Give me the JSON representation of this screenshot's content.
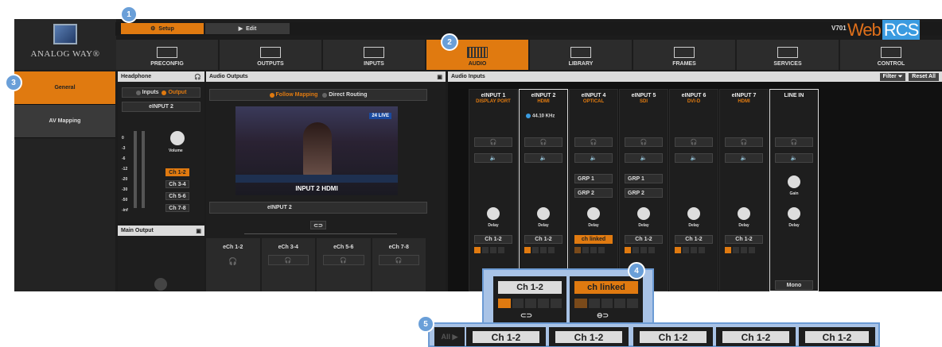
{
  "header": {
    "tabs": [
      {
        "label": "Setup"
      },
      {
        "label": "Edit"
      }
    ],
    "version": "V701",
    "brand_web": "Web",
    "brand_rcs": "RCS",
    "logo_text": "ANALOG WAY®"
  },
  "menu": [
    {
      "label": "PRECONFIG"
    },
    {
      "label": "OUTPUTS"
    },
    {
      "label": "INPUTS"
    },
    {
      "label": "AUDIO"
    },
    {
      "label": "LIBRARY"
    },
    {
      "label": "FRAMES"
    },
    {
      "label": "SERVICES"
    },
    {
      "label": "CONTROL"
    }
  ],
  "sidebar": {
    "items": [
      {
        "label": "General"
      },
      {
        "label": "AV Mapping"
      }
    ]
  },
  "headphone": {
    "title": "Headphone",
    "inputs": "Inputs",
    "output": "Output",
    "source": "eINPUT 2",
    "volume": "Volume",
    "scale": [
      "0",
      "-3",
      "-6",
      "-12",
      "-20",
      "-30",
      "-50",
      "-inf"
    ],
    "channels": [
      "Ch 1-2",
      "Ch 3-4",
      "Ch 5-6",
      "Ch 7-8"
    ]
  },
  "main_output": {
    "title": "Main Output"
  },
  "audio_outputs": {
    "title": "Audio Outputs",
    "follow": "Follow Mapping",
    "direct": "Direct Routing",
    "video_caption": "INPUT 2  HDMI",
    "video_tag": "24 LIVE",
    "selected": "eINPUT 2",
    "link": "⊂⊃",
    "outs": [
      "eCh 1-2",
      "eCh 3-4",
      "eCh 5-6",
      "eCh 7-8"
    ]
  },
  "audio_inputs": {
    "title": "Audio Inputs",
    "filter": "Filter",
    "reset": "Reset All",
    "freq": "44.10 KHz",
    "grp1": "GRP 1",
    "grp2": "GRP 2",
    "delay": "Delay",
    "gain": "Gain",
    "mono": "Mono",
    "channels": [
      {
        "name": "eINPUT 1",
        "type": "DISPLAY PORT",
        "ch": "Ch 1-2"
      },
      {
        "name": "eINPUT 2",
        "type": "HDMI",
        "ch": "Ch 1-2"
      },
      {
        "name": "eINPUT 4",
        "type": "OPTICAL",
        "ch": "ch linked"
      },
      {
        "name": "eINPUT 5",
        "type": "SDI",
        "ch": "Ch 1-2"
      },
      {
        "name": "eINPUT 6",
        "type": "DVI-D",
        "ch": "Ch 1-2"
      },
      {
        "name": "eINPUT 7",
        "type": "HDMI",
        "ch": "Ch 1-2"
      },
      {
        "name": "LINE IN",
        "type": "",
        "ch": ""
      }
    ]
  },
  "zoom": {
    "ch12": "Ch 1-2",
    "linked": "ch linked",
    "link_a": "⊂⊃",
    "link_b": "⊖⊃",
    "all": "All ▶",
    "row": [
      "Ch 1-2",
      "Ch 1-2",
      "Ch 1-2",
      "Ch 1-2",
      "Ch 1-2"
    ]
  },
  "badges": [
    "1",
    "2",
    "3",
    "4",
    "5"
  ]
}
